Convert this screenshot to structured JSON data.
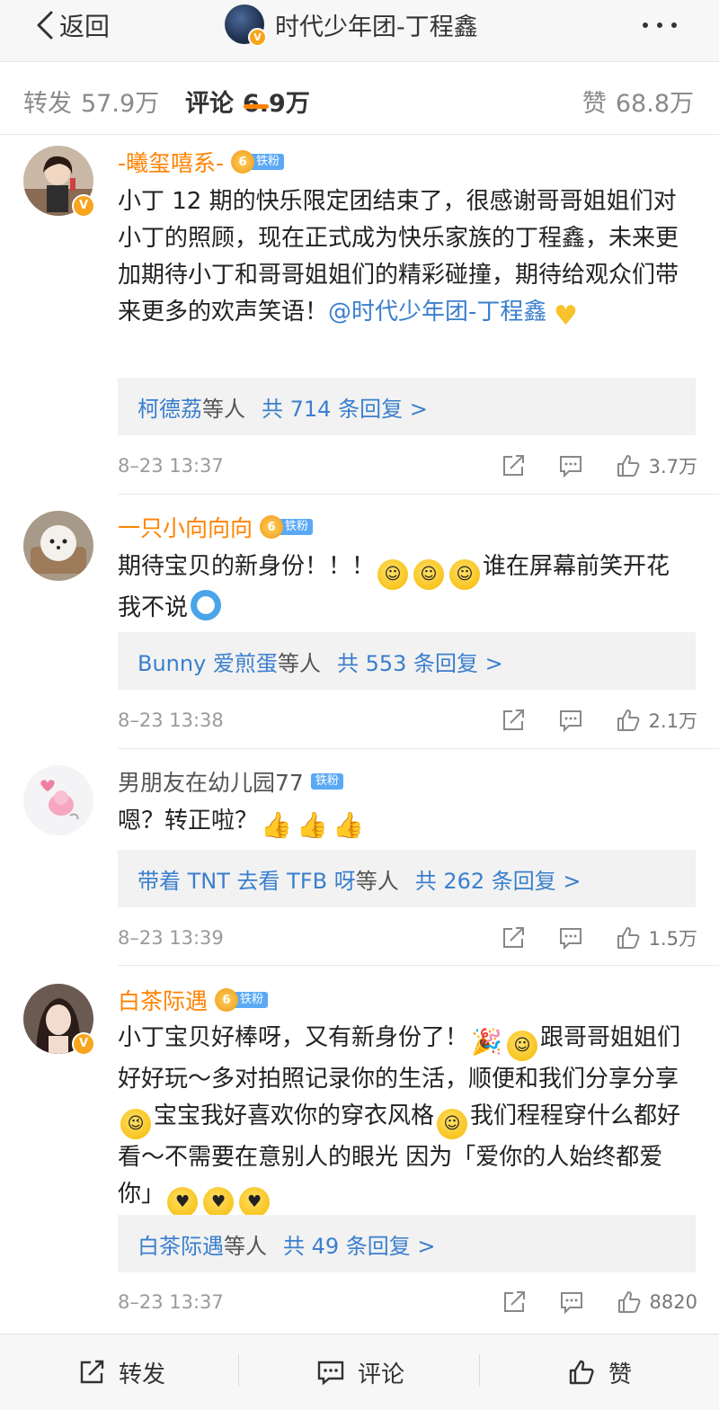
{
  "nav": {
    "back_label": "返回",
    "title": "时代少年团-丁程鑫",
    "verified_mark": "V"
  },
  "tabs": [
    {
      "label": "转发",
      "count": "57.9万"
    },
    {
      "label": "评论",
      "count": "6.9万"
    },
    {
      "label": "赞",
      "count": "68.8万"
    }
  ],
  "fan_badge": "铁粉",
  "comments": [
    {
      "username": "-曦玺嘻系-",
      "fan_level": "6",
      "text_parts": [
        "小丁 12 期的快乐限定团结束了，很感谢哥哥姐姐们对小丁的照顾，现在正式成为快乐家族的丁程鑫，未来更加期待小丁和哥哥姐姐们的精彩碰撞，期待给观众们带来更多的欢声笑语！"
      ],
      "mention": "@时代少年团-丁程鑫",
      "reply_names": "柯德荔",
      "reply_suffix": "等人",
      "reply_count": "共 714 条回复 >",
      "time": "8–23 13:37",
      "likes": "3.7万"
    },
    {
      "username": "一只小向向向",
      "fan_level": "6",
      "text_parts": [
        "期待宝贝的新身份！！！",
        "谁在屏幕前笑开花 我不说"
      ],
      "reply_names": "Bunny 爱煎蛋",
      "reply_suffix": "等人",
      "reply_count": "共 553 条回复 >",
      "time": "8–23 13:38",
      "likes": "2.1万"
    },
    {
      "username": "男朋友在幼儿园77",
      "text_parts": [
        "嗯？转正啦？"
      ],
      "reply_names": "带着 TNT 去看 TFB 呀",
      "reply_suffix": "等人",
      "reply_count": "共 262 条回复 >",
      "time": "8–23 13:39",
      "likes": "1.5万"
    },
    {
      "username": "白茶际遇",
      "fan_level": "6",
      "text_parts": [
        "小丁宝贝好棒呀，又有新身份了！",
        "跟哥哥姐姐们好好玩～多对拍照记录你的生活，顺便和我们分享分享",
        "宝宝我好喜欢你的穿衣风格",
        "我们程程穿什么都好看～不需要在意别人的眼光 因为「爱你的人始终都爱你」"
      ],
      "reply_names": "白茶际遇",
      "reply_suffix": "等人",
      "reply_count": "共 49 条回复 >",
      "time": "8–23 13:37",
      "likes": "8820"
    }
  ],
  "bottom": {
    "repost": "转发",
    "comment": "评论",
    "like": "赞"
  },
  "colors": {
    "accent": "#ff8200",
    "link": "#3a7fcd",
    "fan_badge": "#5aa9f5"
  }
}
